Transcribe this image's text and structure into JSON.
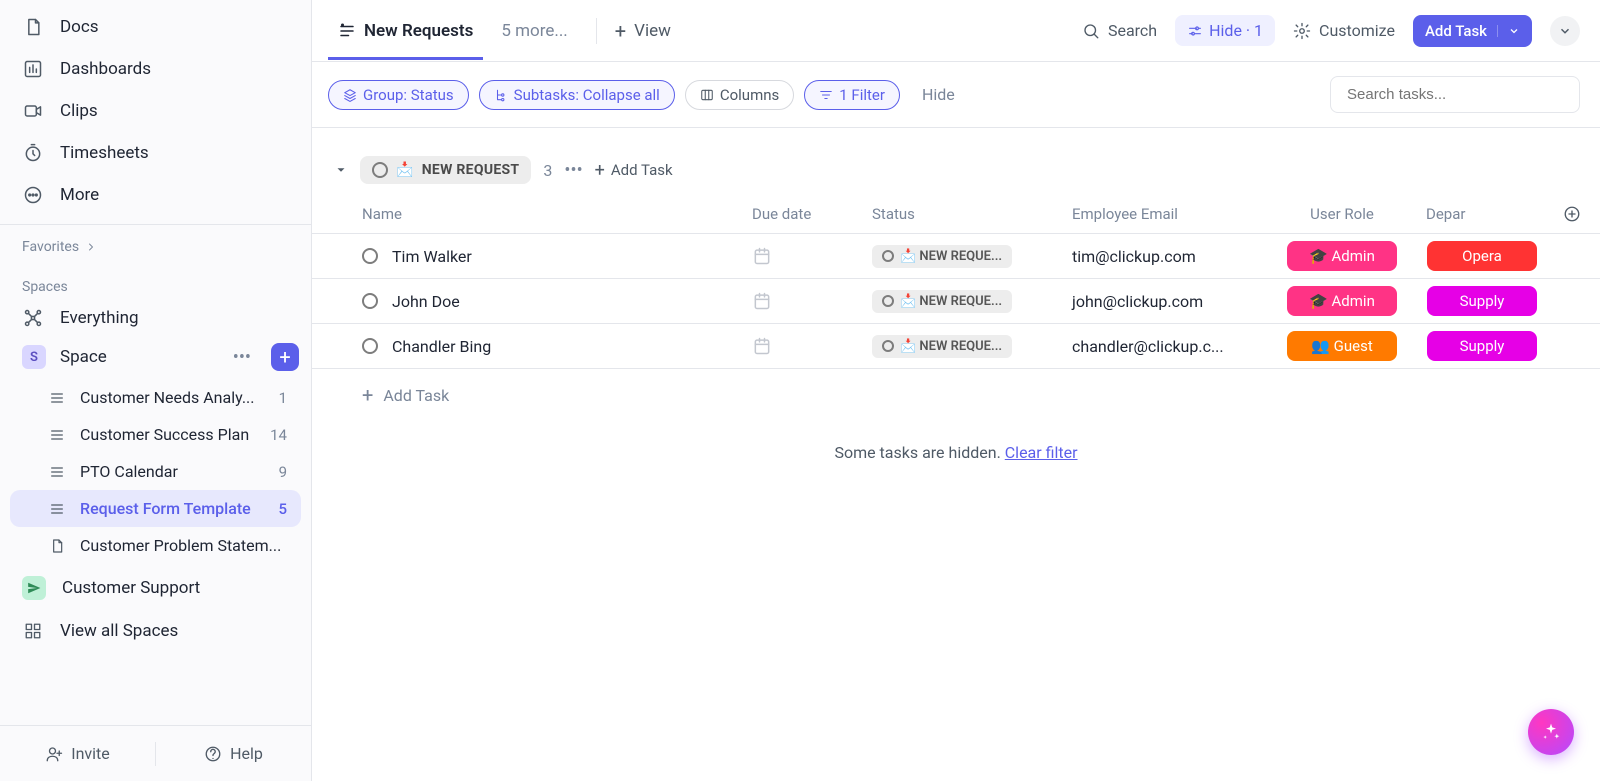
{
  "sidebar": {
    "nav": [
      {
        "label": "Docs",
        "icon": "doc-icon"
      },
      {
        "label": "Dashboards",
        "icon": "dashboard-icon"
      },
      {
        "label": "Clips",
        "icon": "video-icon"
      },
      {
        "label": "Timesheets",
        "icon": "timer-icon"
      },
      {
        "label": "More",
        "icon": "more-icon"
      }
    ],
    "favorites_label": "Favorites",
    "spaces_label": "Spaces",
    "everything_label": "Everything",
    "space": {
      "initial": "S",
      "name": "Space",
      "lists": [
        {
          "name": "Customer Needs Analy...",
          "count": "1"
        },
        {
          "name": "Customer Success Plan",
          "count": "14"
        },
        {
          "name": "PTO Calendar",
          "count": "9"
        },
        {
          "name": "Request Form Template",
          "count": "5",
          "active": true
        },
        {
          "name": "Customer Problem Statem...",
          "count": ""
        }
      ]
    },
    "customer_support_label": "Customer Support",
    "view_all_label": "View all Spaces",
    "invite_label": "Invite",
    "help_label": "Help"
  },
  "topbar": {
    "active_view": "New Requests",
    "more_views": "5 more...",
    "add_view": "View",
    "search_label": "Search",
    "hide_label": "Hide · 1",
    "customize_label": "Customize",
    "add_task_label": "Add Task"
  },
  "filterbar": {
    "group": "Group: Status",
    "subtasks": "Subtasks: Collapse all",
    "columns": "Columns",
    "filter": "1 Filter",
    "hide": "Hide",
    "search_placeholder": "Search tasks..."
  },
  "group": {
    "name": "NEW REQUEST",
    "emoji": "📩",
    "count": "3",
    "add_task": "Add Task"
  },
  "columns": {
    "name": "Name",
    "due": "Due date",
    "status": "Status",
    "email": "Employee Email",
    "role": "User Role",
    "dept": "Depar"
  },
  "rows": [
    {
      "name": "Tim Walker",
      "status": "NEW REQUE...",
      "email": "tim@clickup.com",
      "role": {
        "emoji": "🎓",
        "label": "Admin",
        "color": "pink"
      },
      "dept": {
        "label": "Opera",
        "color": "red"
      }
    },
    {
      "name": "John Doe",
      "status": "NEW REQUE...",
      "email": "john@clickup.com",
      "role": {
        "emoji": "🎓",
        "label": "Admin",
        "color": "pink"
      },
      "dept": {
        "label": "Supply",
        "color": "magenta"
      }
    },
    {
      "name": "Chandler Bing",
      "status": "NEW REQUE...",
      "email": "chandler@clickup.c...",
      "role": {
        "emoji": "👥",
        "label": "Guest",
        "color": "orange"
      },
      "dept": {
        "label": "Supply",
        "color": "magenta"
      }
    }
  ],
  "add_task_row": "Add Task",
  "hidden_msg": "Some tasks are hidden. ",
  "clear_filter": "Clear filter"
}
